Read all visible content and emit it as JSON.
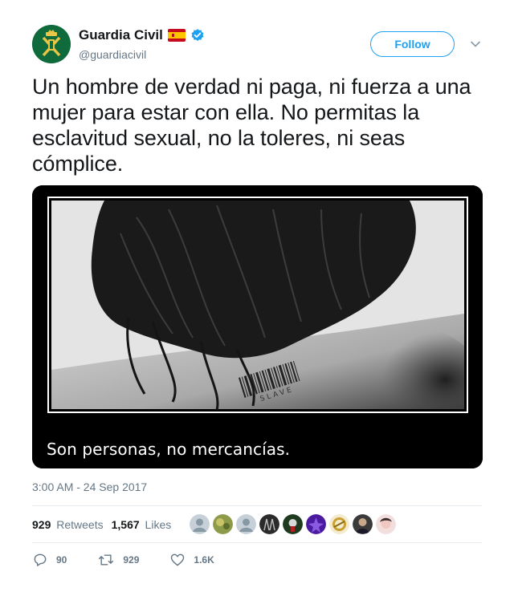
{
  "account": {
    "display_name": "Guardia Civil",
    "handle": "@guardiacivil",
    "verified": true,
    "flag": "spain-flag-icon",
    "follow_label": "Follow"
  },
  "tweet": {
    "text": "Un hombre de verdad ni paga, ni fuerza a una mujer para estar con ella. No permitas la esclavitud sexual, no la toleres, ni seas cómplice.",
    "timestamp": "3:00 AM - 24 Sep 2017"
  },
  "media": {
    "caption": "Son personas, no mercancías.",
    "barcode_text": "SLAVE"
  },
  "stats": {
    "retweets_count": "929",
    "retweets_label": "Retweets",
    "likes_count": "1,567",
    "likes_label": "Likes"
  },
  "actions": {
    "reply_count": "90",
    "retweet_count": "929",
    "like_count": "1.6K"
  },
  "colors": {
    "accent": "#1da1f2",
    "text": "#14171a",
    "muted": "#657786",
    "avatar_green": "#0f6b3b"
  }
}
